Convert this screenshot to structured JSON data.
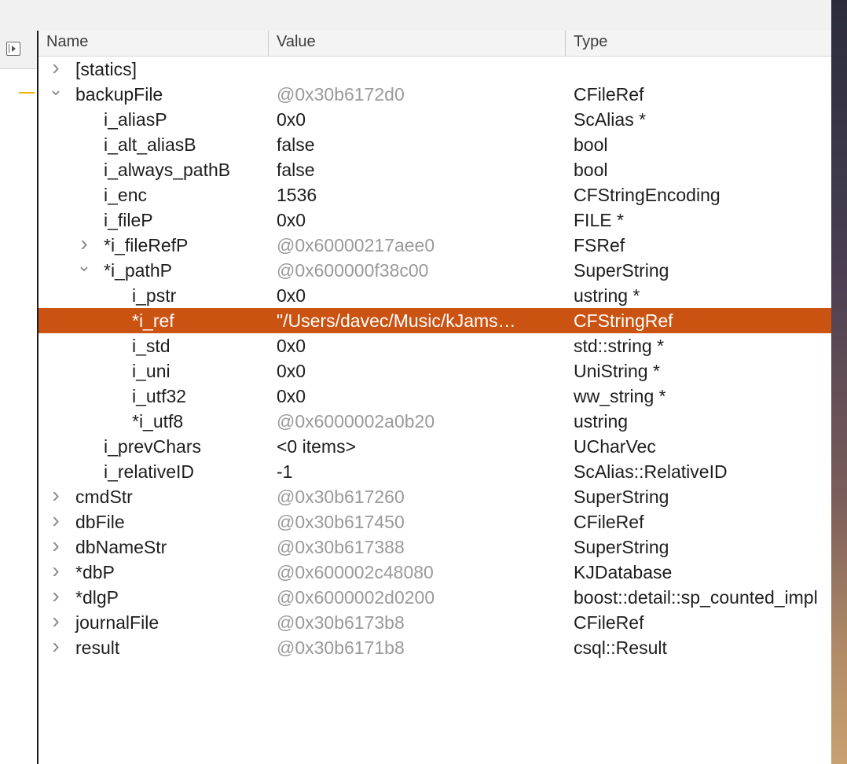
{
  "columns": {
    "name": "Name",
    "value": "Value",
    "type": "Type"
  },
  "icons": {
    "sidebar_toggle": "sidebar-toggle-icon",
    "collapsed": "chevron-right-icon",
    "expanded": "chevron-down-icon"
  },
  "colors": {
    "selection": "#cb5312",
    "address_text": "#9a9a9a",
    "marker": "#f0b400"
  },
  "rows": [
    {
      "name": "[statics]",
      "value": "",
      "type": "",
      "depth": 0,
      "disclosure": "collapsed",
      "addr": false,
      "selected": false
    },
    {
      "name": "backupFile",
      "value": "@0x30b6172d0",
      "type": "CFileRef",
      "depth": 0,
      "disclosure": "expanded",
      "addr": true,
      "selected": false
    },
    {
      "name": "i_aliasP",
      "value": "0x0",
      "type": "ScAlias *",
      "depth": 1,
      "disclosure": "none",
      "addr": false,
      "selected": false
    },
    {
      "name": "i_alt_aliasB",
      "value": "false",
      "type": "bool",
      "depth": 1,
      "disclosure": "none",
      "addr": false,
      "selected": false
    },
    {
      "name": "i_always_pathB",
      "value": "false",
      "type": "bool",
      "depth": 1,
      "disclosure": "none",
      "addr": false,
      "selected": false
    },
    {
      "name": "i_enc",
      "value": "1536",
      "type": "CFStringEncoding",
      "depth": 1,
      "disclosure": "none",
      "addr": false,
      "selected": false
    },
    {
      "name": "i_fileP",
      "value": "0x0",
      "type": "FILE *",
      "depth": 1,
      "disclosure": "none",
      "addr": false,
      "selected": false
    },
    {
      "name": "*i_fileRefP",
      "value": "@0x60000217aee0",
      "type": "FSRef",
      "depth": 1,
      "disclosure": "collapsed",
      "addr": true,
      "selected": false
    },
    {
      "name": "*i_pathP",
      "value": "@0x600000f38c00",
      "type": "SuperString",
      "depth": 1,
      "disclosure": "expanded",
      "addr": true,
      "selected": false
    },
    {
      "name": "i_pstr",
      "value": "0x0",
      "type": "ustring *",
      "depth": 2,
      "disclosure": "none",
      "addr": false,
      "selected": false
    },
    {
      "name": "*i_ref",
      "value": "\"/Users/davec/Music/kJams…",
      "type": "CFStringRef",
      "depth": 2,
      "disclosure": "none",
      "addr": false,
      "selected": true
    },
    {
      "name": "i_std",
      "value": "0x0",
      "type": "std::string *",
      "depth": 2,
      "disclosure": "none",
      "addr": false,
      "selected": false
    },
    {
      "name": "i_uni",
      "value": "0x0",
      "type": "UniString *",
      "depth": 2,
      "disclosure": "none",
      "addr": false,
      "selected": false
    },
    {
      "name": "i_utf32",
      "value": "0x0",
      "type": "ww_string *",
      "depth": 2,
      "disclosure": "none",
      "addr": false,
      "selected": false
    },
    {
      "name": "*i_utf8",
      "value": "@0x6000002a0b20",
      "type": "ustring",
      "depth": 2,
      "disclosure": "none",
      "addr": true,
      "selected": false
    },
    {
      "name": "i_prevChars",
      "value": "<0 items>",
      "type": "UCharVec",
      "depth": 1,
      "disclosure": "none",
      "addr": false,
      "selected": false
    },
    {
      "name": "i_relativeID",
      "value": "-1",
      "type": "ScAlias::RelativeID",
      "depth": 1,
      "disclosure": "none",
      "addr": false,
      "selected": false
    },
    {
      "name": "cmdStr",
      "value": "@0x30b617260",
      "type": "SuperString",
      "depth": 0,
      "disclosure": "collapsed",
      "addr": true,
      "selected": false
    },
    {
      "name": "dbFile",
      "value": "@0x30b617450",
      "type": "CFileRef",
      "depth": 0,
      "disclosure": "collapsed",
      "addr": true,
      "selected": false
    },
    {
      "name": "dbNameStr",
      "value": "@0x30b617388",
      "type": "SuperString",
      "depth": 0,
      "disclosure": "collapsed",
      "addr": true,
      "selected": false
    },
    {
      "name": "*dbP",
      "value": "@0x600002c48080",
      "type": "KJDatabase",
      "depth": 0,
      "disclosure": "collapsed",
      "addr": true,
      "selected": false
    },
    {
      "name": "*dlgP",
      "value": "@0x6000002d0200",
      "type": "boost::detail::sp_counted_impl",
      "depth": 0,
      "disclosure": "collapsed",
      "addr": true,
      "selected": false
    },
    {
      "name": "journalFile",
      "value": "@0x30b6173b8",
      "type": "CFileRef",
      "depth": 0,
      "disclosure": "collapsed",
      "addr": true,
      "selected": false
    },
    {
      "name": "result",
      "value": "@0x30b6171b8",
      "type": "csql::Result",
      "depth": 0,
      "disclosure": "collapsed",
      "addr": true,
      "selected": false
    }
  ]
}
